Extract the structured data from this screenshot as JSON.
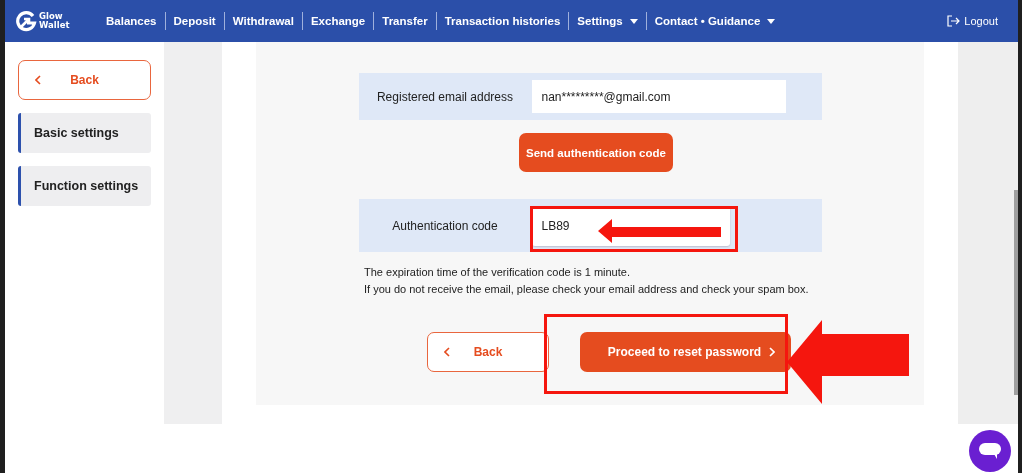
{
  "navbar": {
    "logo": {
      "line_1": "Glow",
      "line_2": "Wallet"
    },
    "items": [
      {
        "label": "Balances",
        "dropdown": false
      },
      {
        "label": "Deposit",
        "dropdown": false
      },
      {
        "label": "Withdrawal",
        "dropdown": false
      },
      {
        "label": "Exchange",
        "dropdown": false
      },
      {
        "label": "Transfer",
        "dropdown": false
      },
      {
        "label": "Transaction histories",
        "dropdown": false
      },
      {
        "label": "Settings",
        "dropdown": true
      },
      {
        "label": "Contact • Guidance",
        "dropdown": true
      }
    ],
    "logout": "Logout"
  },
  "sidebar": {
    "back": "Back",
    "items": [
      {
        "label": "Basic settings"
      },
      {
        "label": "Function settings"
      }
    ]
  },
  "form": {
    "email": {
      "label": "Registered email address",
      "value": "nan*********@gmail.com"
    },
    "send_button": "Send authentication code",
    "code": {
      "label": "Authentication code",
      "value": "LB89"
    },
    "notes": [
      "The expiration time of the verification code is 1 minute.",
      "If you do not receive the email, please check your email address and check your spam box."
    ],
    "back_button": "Back",
    "proceed_button": "Proceed to reset password"
  }
}
